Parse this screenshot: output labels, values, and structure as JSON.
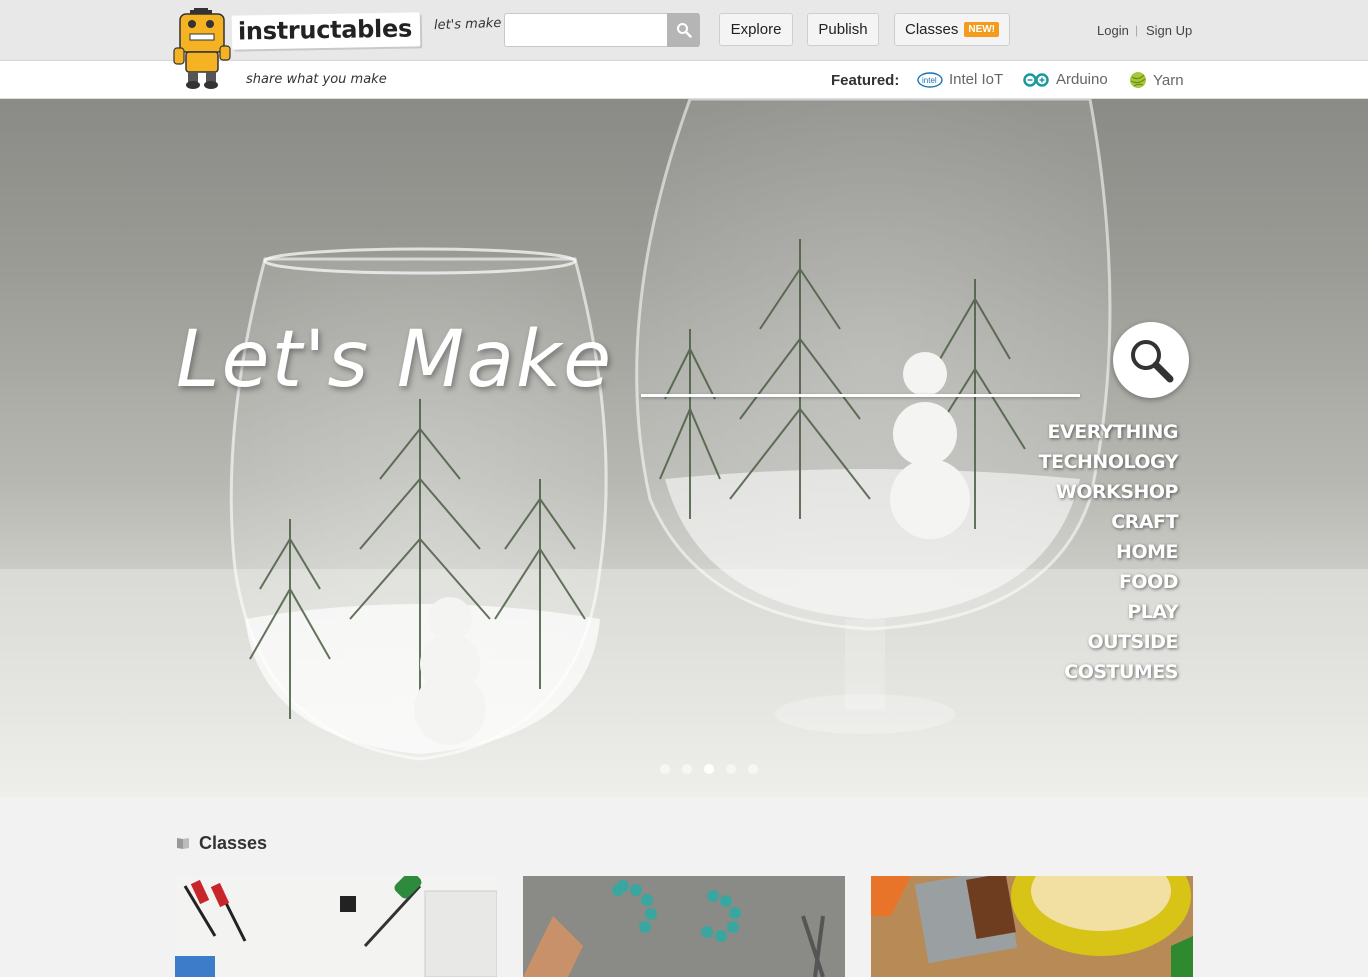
{
  "brand": {
    "logo_text": "instructables",
    "tagline": "share what you make",
    "lets_make_small": "let's make"
  },
  "search": {
    "placeholder": "",
    "icon": "search-icon"
  },
  "nav": {
    "explore": "Explore",
    "publish": "Publish",
    "classes": "Classes",
    "classes_badge": "NEW!"
  },
  "auth": {
    "login": "Login",
    "separator": "|",
    "signup": "Sign Up"
  },
  "featured": {
    "label": "Featured:",
    "items": [
      {
        "label": "Intel IoT",
        "icon": "intel-icon"
      },
      {
        "label": "Arduino",
        "icon": "arduino-icon"
      },
      {
        "label": "Yarn",
        "icon": "yarn-icon"
      }
    ]
  },
  "hero": {
    "title": "Let's Make",
    "categories": [
      "EVERYTHING",
      "TECHNOLOGY",
      "WORKSHOP",
      "CRAFT",
      "HOME",
      "FOOD",
      "PLAY",
      "OUTSIDE",
      "COSTUMES"
    ],
    "slide_count": 5,
    "active_slide": 3
  },
  "classes_section": {
    "title": "Classes",
    "icon": "book-icon"
  },
  "colors": {
    "accent_orange": "#f29b1d",
    "header_bg": "#e8e8e8"
  }
}
